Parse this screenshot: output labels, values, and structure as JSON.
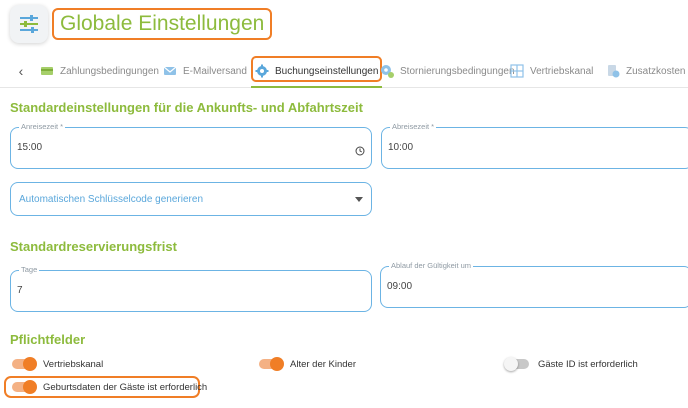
{
  "header": {
    "title": "Globale Einstellungen",
    "icon": "sliders-icon",
    "accent": "#8dbb3d",
    "highlight": "#f07e26"
  },
  "tabs": [
    {
      "label": "Zahlungsbedingungen",
      "icon": "payment-icon",
      "active": false
    },
    {
      "label": "E-Mailversand",
      "icon": "mail-icon",
      "active": false
    },
    {
      "label": "Buchungseinstellungen",
      "icon": "gear-icon",
      "active": true
    },
    {
      "label": "Stornierungsbedingungen",
      "icon": "cancel-gear-icon",
      "active": false
    },
    {
      "label": "Vertriebskanal",
      "icon": "grid-icon",
      "active": false
    },
    {
      "label": "Zusatzkosten",
      "icon": "costs-icon",
      "active": false
    }
  ],
  "sections": {
    "arrival": {
      "title": "Standardeinstellungen für die Ankunfts- und Abfahrtszeit",
      "arrival_label": "Anreisezeit *",
      "arrival_value": "15:00",
      "departure_label": "Abreisezeit *",
      "departure_value": "10:00",
      "key_code_select": "Automatischen Schlüsselcode generieren"
    },
    "reservation": {
      "title": "Standardreservierungsfrist",
      "days_label": "Tage",
      "days_value": "7",
      "expiry_label": "Ablauf der Gültigkeit um",
      "expiry_value": "09:00"
    },
    "required": {
      "title": "Pflichtfelder",
      "toggles": [
        {
          "label": "Vertriebskanal",
          "on": true
        },
        {
          "label": "Alter der Kinder",
          "on": true
        },
        {
          "label": "Gäste ID ist erforderlich",
          "on": false
        },
        {
          "label": "Geburtsdaten der Gäste ist erforderlich",
          "on": true
        }
      ]
    }
  }
}
